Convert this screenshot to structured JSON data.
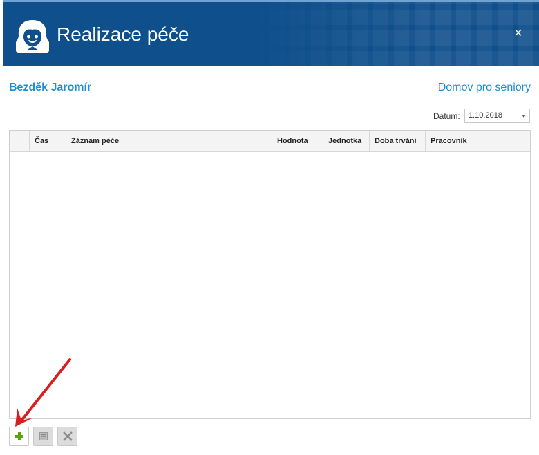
{
  "window": {
    "title": "Realizace péče",
    "close_label": "×",
    "avatar_icon": "resident-face-icon",
    "header_color": "#0f4f8c"
  },
  "patient": {
    "name": "Bezděk Jaromír",
    "facility": "Domov pro seniory"
  },
  "filter": {
    "date_label": "Datum:",
    "date_value": "1.10.2018"
  },
  "grid": {
    "columns": [
      "",
      "Čas",
      "Záznam péče",
      "Hodnota",
      "Jednotka",
      "Doba trvání",
      "Pracovník"
    ],
    "rows": []
  },
  "toolbar": {
    "add_icon": "plus-icon",
    "edit_icon": "document-edit-icon",
    "delete_icon": "x-delete-icon",
    "add_color": "#5aa600"
  },
  "annotation": {
    "arrow_color": "#d81e1e"
  }
}
